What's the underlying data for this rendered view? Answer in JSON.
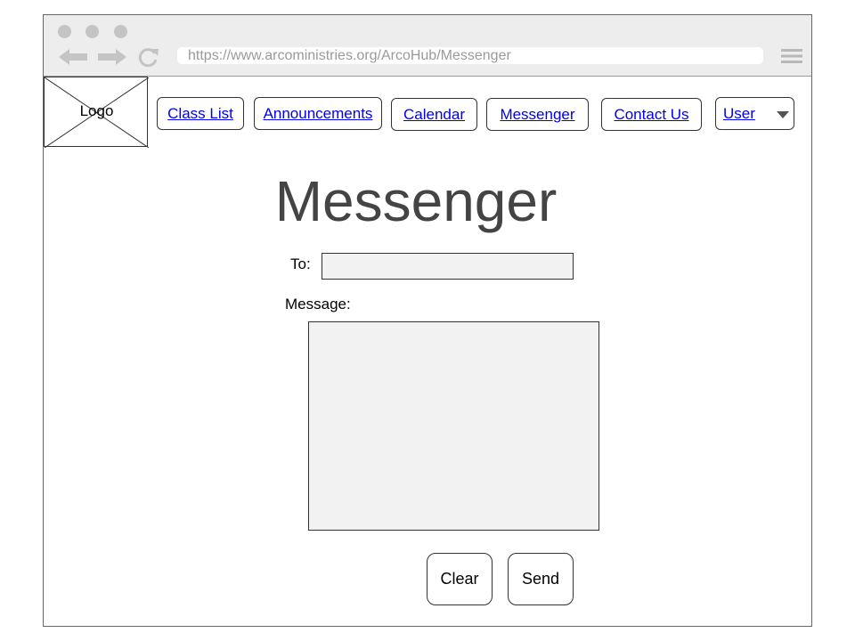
{
  "browser": {
    "url": "https://www.arcoministries.org/ArcoHub/Messenger",
    "icons": [
      "back-arrow-icon",
      "forward-arrow-icon",
      "reload-icon",
      "hamburger-menu-icon"
    ]
  },
  "header": {
    "logo_text": "Logo",
    "nav": {
      "class_list": "Class List",
      "announcements": "Announcements",
      "calendar": "Calendar",
      "messenger": "Messenger",
      "contact_us": "Contact Us",
      "user": "User"
    }
  },
  "main": {
    "title": "Messenger",
    "to_label": "To:",
    "to_value": "",
    "message_label": "Message:",
    "message_value": "",
    "clear_label": "Clear",
    "send_label": "Send"
  },
  "colors": {
    "link": "#0000ee",
    "title": "#444444",
    "field_bg": "#f2f2f2",
    "chrome_bg": "#ededed"
  }
}
